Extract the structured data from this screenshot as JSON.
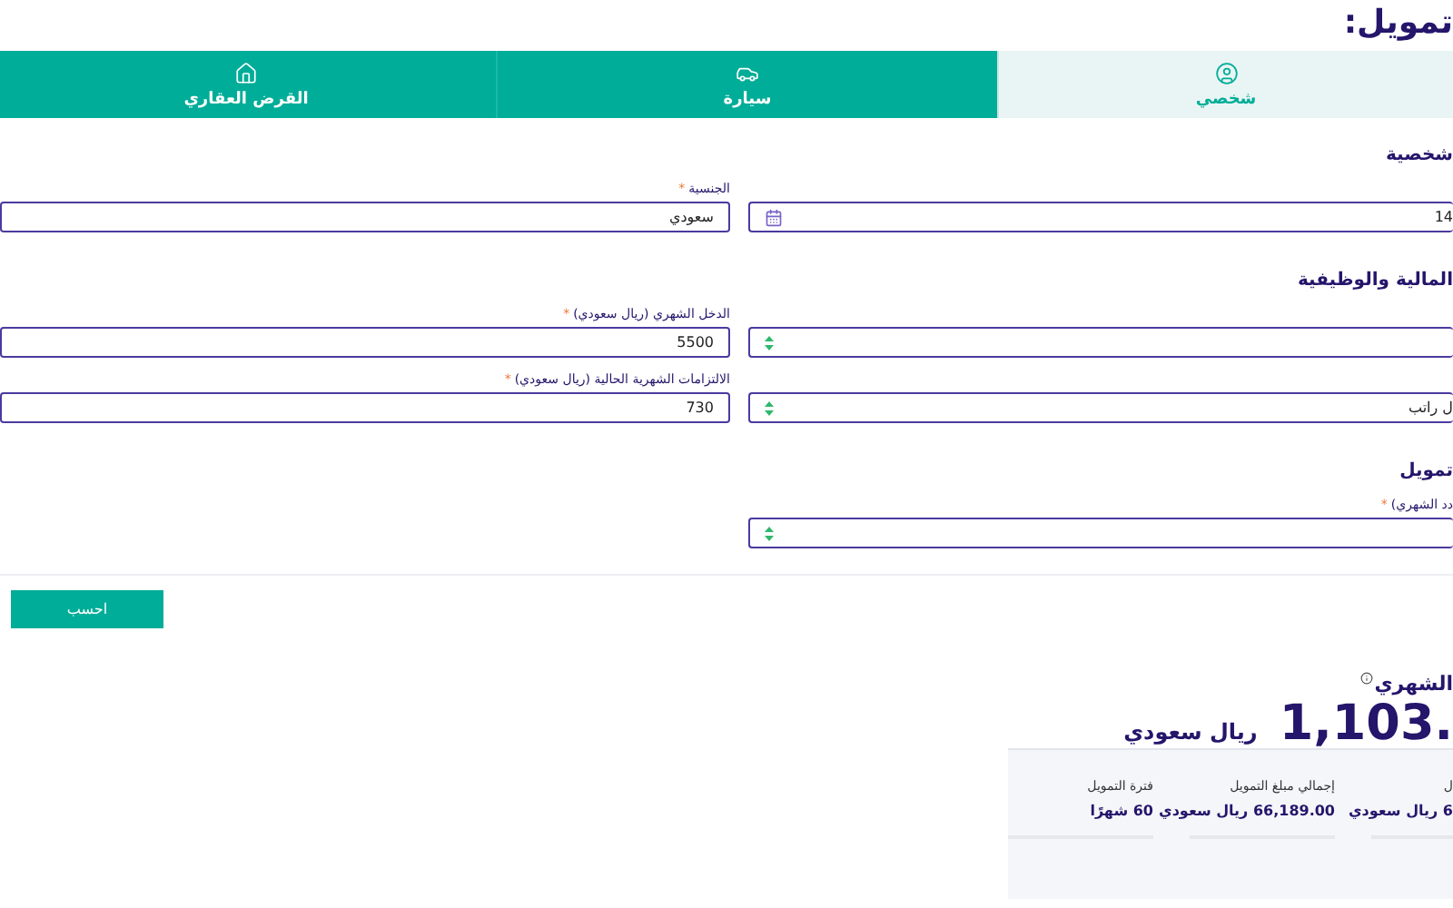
{
  "heading": "تمويل:",
  "tabs": [
    {
      "label": "شخصي",
      "kind": "user",
      "selected": true
    },
    {
      "label": "سيارة",
      "kind": "car",
      "selected": false
    },
    {
      "label": "القرض العقاري",
      "kind": "house",
      "selected": false
    }
  ],
  "sections": [
    {
      "title": "شخصية",
      "fields": [
        {
          "kind": "date",
          "value": "14"
        },
        {
          "kind": "text",
          "label": "الجنسية",
          "required_mark": "*",
          "value": "سعودي"
        }
      ]
    },
    {
      "title": "المالية والوظيفية",
      "fields": [
        {
          "kind": "select"
        },
        {
          "kind": "text",
          "label": "الدخل الشهري (ريال سعودي)",
          "required_mark": "*",
          "value": "5500"
        },
        {
          "kind": "select",
          "value": "ل راتب"
        },
        {
          "kind": "text",
          "label": "الالتزامات الشهرية الحالية (ريال سعودي)",
          "required_mark": "*",
          "value": "730"
        }
      ]
    },
    {
      "title": "تمويل",
      "fields": [
        {
          "kind": "select",
          "label": "دد الشهري)",
          "required_mark": "*"
        }
      ]
    }
  ],
  "button": "احسب",
  "result": {
    "label": "الشهري",
    "amount": "1,103.",
    "currency": "ريال سعودي",
    "stats": [
      {
        "label": "ل",
        "value": "6 ريال سعودي"
      },
      {
        "label": "إجمالي مبلغ التمويل",
        "value": "66,189.00 ريال سعودي"
      },
      {
        "label": "فترة التمويل",
        "value": "60 شهرًا"
      }
    ]
  }
}
